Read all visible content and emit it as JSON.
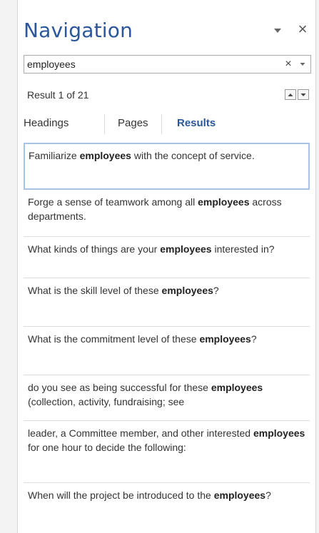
{
  "pane": {
    "title": "Navigation"
  },
  "search": {
    "value": "employees",
    "placeholder": "",
    "clear_glyph": "×"
  },
  "close_glyph": "×",
  "result_count": "Result 1 of 21",
  "tabs": [
    {
      "label": "Headings"
    },
    {
      "label": "Pages"
    },
    {
      "label": "Results"
    }
  ],
  "results": [
    {
      "before": "Familiarize ",
      "match": "employees",
      "after": " with the concept of service."
    },
    {
      "before": "Forge a sense of teamwork among all ",
      "match": "employees",
      "after": " across departments."
    },
    {
      "before": "What kinds of things are your ",
      "match": "employees",
      "after": " interested in?"
    },
    {
      "before": "What is the skill level of these ",
      "match": "employees",
      "after": "?"
    },
    {
      "before": "What is the commitment level of these ",
      "match": "employees",
      "after": "?"
    },
    {
      "before": "do you see as being successful for these ",
      "match": "employees",
      "after": " (collection, activity, fundraising; see"
    },
    {
      "before": "leader, a Committee member, and other interested ",
      "match": "employees",
      "after": " for one hour to decide the following:"
    },
    {
      "before": "When will the project be introduced to the ",
      "match": "employees",
      "after": "?"
    }
  ],
  "colors": {
    "accent": "#2b579a",
    "selection_border": "#a8c2e6"
  },
  "icons": {
    "menu": "chevron-down-icon",
    "close": "close-icon",
    "prev": "up-arrow-icon",
    "next": "down-arrow-icon"
  }
}
